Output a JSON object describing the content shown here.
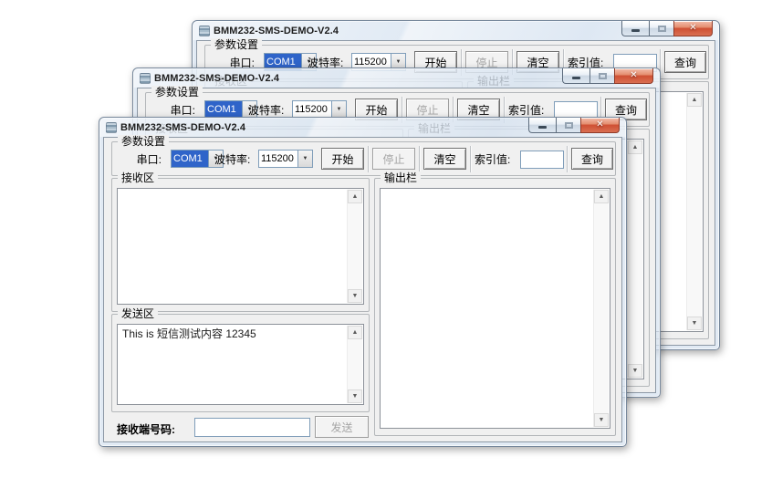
{
  "app": {
    "title": "BMM232-SMS-DEMO-V2.4",
    "params": {
      "group_label": "参数设置",
      "serial_label": "串口:",
      "serial_value": "COM1",
      "baud_label": "波特率:",
      "baud_value": "115200",
      "start_label": "开始",
      "stop_label": "停止",
      "clear_label": "清空",
      "index_label": "索引值:",
      "index_value": "",
      "query_label": "查询"
    },
    "receive": {
      "group_label": "接收区",
      "content": ""
    },
    "send": {
      "group_label": "发送区",
      "content": "This is 短信测试内容 12345"
    },
    "output": {
      "group_label": "输出栏",
      "content": ""
    },
    "bottom": {
      "number_label": "接收端号码:",
      "number_value": "",
      "send_label": "发送"
    }
  },
  "icons": {
    "close": "✕",
    "dropdown": "▼",
    "scroll_up": "▲",
    "scroll_down": "▼"
  },
  "colors": {
    "selection_blue": "#2f64c9",
    "close_button_red": "#cf5034",
    "frame_glass": "#d6e2f0",
    "client_bg": "#f0f0f0"
  }
}
